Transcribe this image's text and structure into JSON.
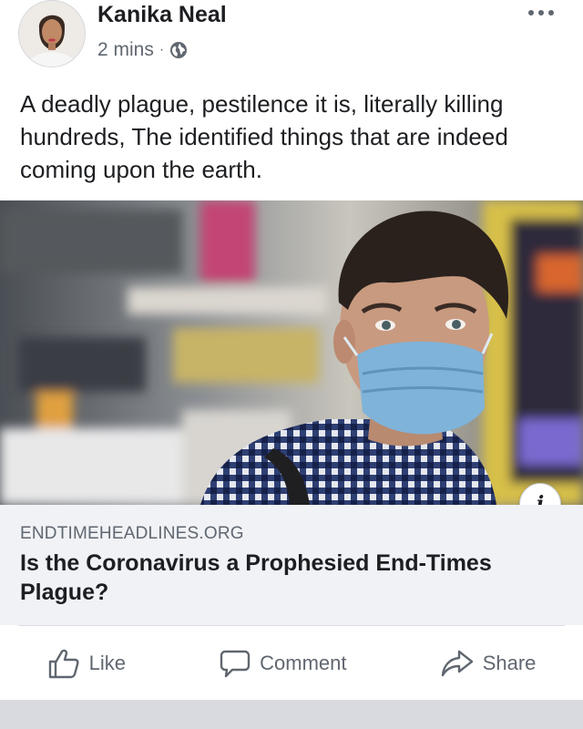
{
  "post": {
    "author": {
      "name": "Kanika Neal",
      "avatar_icon": "profile-photo"
    },
    "meta": {
      "time": "2 mins",
      "separator": "·",
      "privacy_icon": "globe-icon"
    },
    "more_icon": "more-options-icon",
    "text": "A deadly plague, pestilence it is, literally killing hundreds, The identified things that are indeed coming upon the earth.",
    "link_preview": {
      "image_description_icon": "masked-man-photo",
      "info_label": "i",
      "domain": "ENDTIMEHEADLINES.ORG",
      "title": "Is the Coronavirus a Prophesied End-Times Plague?"
    },
    "actions": {
      "like_label": "Like",
      "comment_label": "Comment",
      "share_label": "Share"
    }
  },
  "colors": {
    "text_primary": "#1c1e21",
    "text_secondary": "#606770",
    "caption_background": "#f0f2f5",
    "mask_blue": "#7fb3d9"
  }
}
